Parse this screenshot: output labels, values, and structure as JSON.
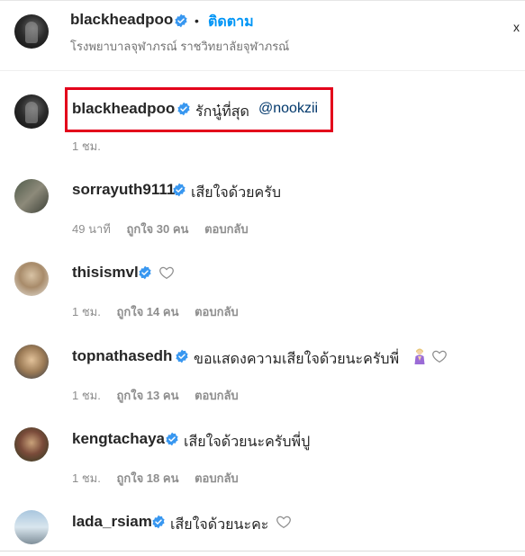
{
  "header": {
    "username": "blackheadpoo",
    "dot": "•",
    "follow_label": "ติดตาม",
    "location": "โรงพยาบาลจุฬาภรณ์ ราชวิทยาลัยจุฬาภรณ์",
    "close_glyph": "x"
  },
  "caption": {
    "username": "blackheadpoo",
    "text": "รักนู๋ที่สุด",
    "mention": "@nookzii",
    "time": "1 ชม."
  },
  "comments": [
    {
      "username": "sorrayuth9111",
      "text": "เสียใจด้วยครับ",
      "time": "49 นาที",
      "likes": "ถูกใจ 30 คน",
      "reply": "ตอบกลับ",
      "verified": true
    },
    {
      "username": "thisismvl",
      "text": "",
      "time": "1 ชม.",
      "likes": "ถูกใจ 14 คน",
      "reply": "ตอบกลับ",
      "verified": true
    },
    {
      "username": "topnathasedh",
      "text": "ขอแสดงความเสียใจด้วยนะครับพี่",
      "time": "1 ชม.",
      "likes": "ถูกใจ 13 คน",
      "reply": "ตอบกลับ",
      "verified": true
    },
    {
      "username": "kengtachaya",
      "text": "เสียใจด้วยนะครับพี่ปู",
      "time": "1 ชม.",
      "likes": "ถูกใจ 18 คน",
      "reply": "ตอบกลับ",
      "verified": true
    },
    {
      "username": "lada_rsiam",
      "text": "เสียใจด้วยนะคะ",
      "time": "",
      "likes": "",
      "reply": "",
      "verified": true
    }
  ],
  "colors": {
    "verified_blue": "#3897f0",
    "follow_blue": "#0095f6",
    "highlight_red": "#e3001b"
  },
  "icons": [
    "verified-badge-icon",
    "heart-outline-icon",
    "close-icon",
    "person-emoji-icon"
  ]
}
